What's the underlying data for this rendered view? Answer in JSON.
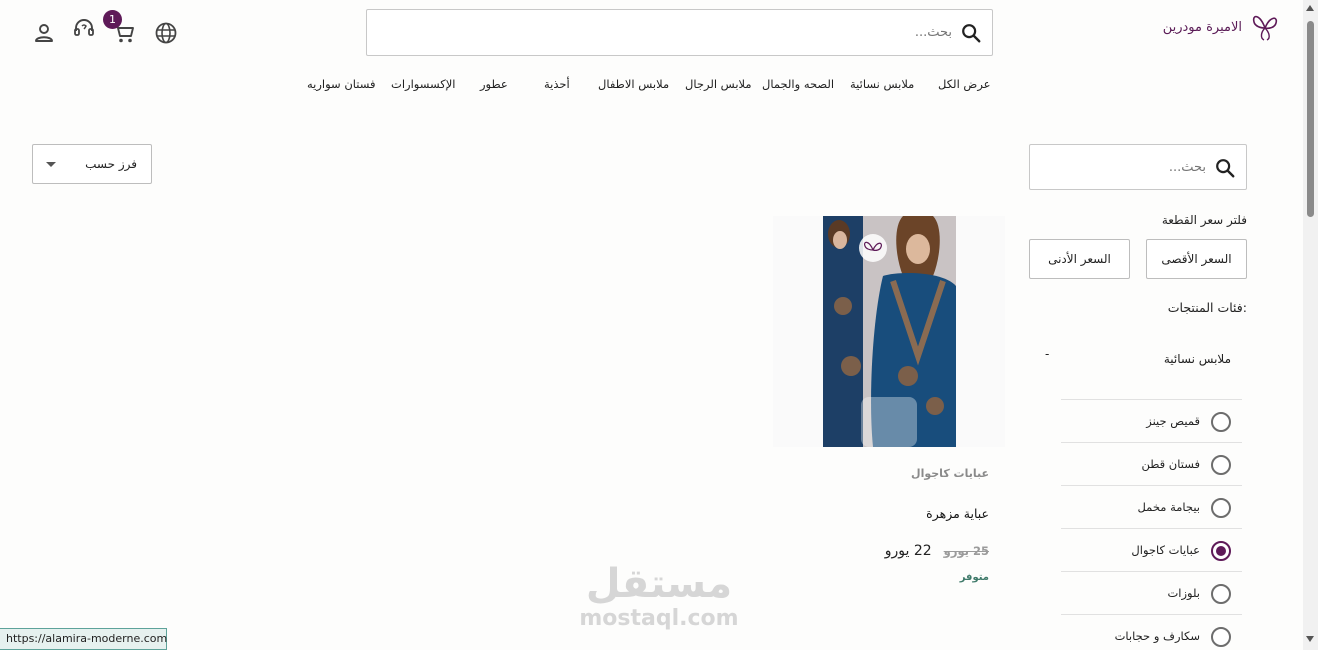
{
  "brand": {
    "name": "الاميرة مودرين"
  },
  "header": {
    "search_placeholder": "بحث...",
    "cart_count": "1"
  },
  "nav": {
    "items": [
      "عرض الكل",
      "ملابس نسائية",
      "الصحه والجمال",
      "ملابس الرجال",
      "ملابس الاطفال",
      "أحذية",
      "عطور",
      "الإكسسوارات",
      "فستان سواريه"
    ]
  },
  "sort": {
    "label": "فرز حسب"
  },
  "sidebar": {
    "search_placeholder": "بحث...",
    "price_filter_title": "فلتر سعر القطعة",
    "max_price_label": "السعر الأقصى",
    "min_price_label": "السعر الأدنى",
    "categories_title": "فئات المنتجات:",
    "parent_category": "ملابس نسائية",
    "collapse_symbol": "-",
    "categories": [
      {
        "label": "قميص جينز",
        "selected": false
      },
      {
        "label": "فستان قطن",
        "selected": false
      },
      {
        "label": "بيجامة مخمل",
        "selected": false
      },
      {
        "label": "عبايات كاجوال",
        "selected": true
      },
      {
        "label": "بلوزات",
        "selected": false
      },
      {
        "label": "سكارف و حجابات",
        "selected": false
      }
    ]
  },
  "product": {
    "category": "عبايات كاجوال",
    "name": "عباية مزهرة",
    "old_price": "25 يورو",
    "new_price": "22 يورو",
    "availability": "متوفر"
  },
  "watermark": {
    "arabic": "مستقل",
    "latin": "mostaql.com"
  },
  "status_bar": {
    "url": "https://alamira-moderne.com"
  },
  "colors": {
    "accent": "#5e1a58",
    "available": "#3f7a6a"
  }
}
